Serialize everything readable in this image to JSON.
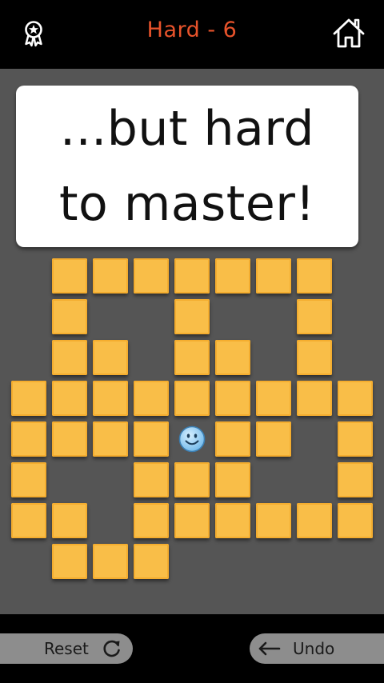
{
  "header": {
    "title": "Hard - 6",
    "title_color": "#e8532b",
    "left_icon": "award-ribbon-icon",
    "right_icon": "home-icon"
  },
  "message": {
    "line1": "...but hard",
    "line2": "to master!"
  },
  "board": {
    "background": "#555555",
    "tile_color": "#f9be48",
    "tiles": [
      [
        1,
        0
      ],
      [
        2,
        0
      ],
      [
        3,
        0
      ],
      [
        4,
        0
      ],
      [
        5,
        0
      ],
      [
        6,
        0
      ],
      [
        7,
        0
      ],
      [
        1,
        1
      ],
      [
        4,
        1
      ],
      [
        7,
        1
      ],
      [
        1,
        2
      ],
      [
        2,
        2
      ],
      [
        4,
        2
      ],
      [
        5,
        2
      ],
      [
        7,
        2
      ],
      [
        0,
        3
      ],
      [
        1,
        3
      ],
      [
        2,
        3
      ],
      [
        3,
        3
      ],
      [
        4,
        3
      ],
      [
        5,
        3
      ],
      [
        6,
        3
      ],
      [
        7,
        3
      ],
      [
        8,
        3
      ],
      [
        0,
        4
      ],
      [
        1,
        4
      ],
      [
        2,
        4
      ],
      [
        3,
        4
      ],
      [
        5,
        4
      ],
      [
        6,
        4
      ],
      [
        8,
        4
      ],
      [
        0,
        5
      ],
      [
        3,
        5
      ],
      [
        4,
        5
      ],
      [
        5,
        5
      ],
      [
        8,
        5
      ],
      [
        0,
        6
      ],
      [
        1,
        6
      ],
      [
        3,
        6
      ],
      [
        4,
        6
      ],
      [
        5,
        6
      ],
      [
        6,
        6
      ],
      [
        7,
        6
      ],
      [
        8,
        6
      ],
      [
        1,
        7
      ],
      [
        2,
        7
      ],
      [
        3,
        7
      ]
    ],
    "player": {
      "col": 4,
      "row": 4,
      "icon": "smiley-face-icon"
    }
  },
  "footer": {
    "reset_label": "Reset",
    "reset_icon": "refresh-icon",
    "undo_label": "Undo",
    "undo_icon": "arrow-left-icon"
  }
}
